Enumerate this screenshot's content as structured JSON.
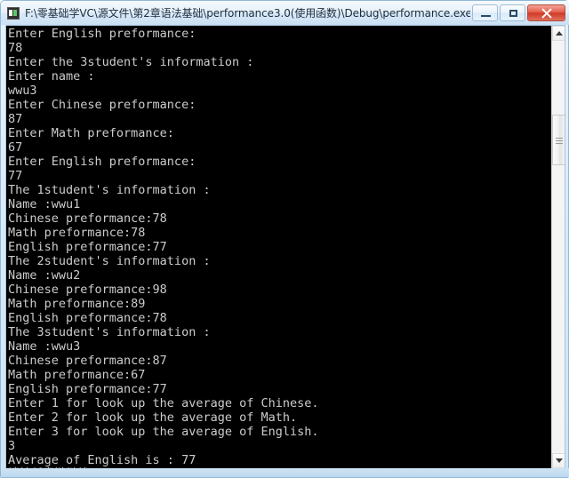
{
  "window": {
    "title": "F:\\零基础学VC\\源文件\\第2章语法基础\\performance3.0(使用函数)\\Debug\\performance.exe",
    "icon": "console-app-icon",
    "frame_color": "#cfe3f5",
    "titlebar_text_color": "#1b2d3f"
  },
  "caption_buttons": {
    "minimize_label": "Minimize",
    "maximize_label": "Maximize",
    "close_label": "Close",
    "close_color": "#cf3a26"
  },
  "console": {
    "background": "#000000",
    "foreground": "#cccccc",
    "lines": [
      "Enter English preformance:",
      "78",
      "Enter the 3student's information :",
      "Enter name :",
      "wwu3",
      "Enter Chinese preformance:",
      "87",
      "Enter Math preformance:",
      "67",
      "Enter English preformance:",
      "77",
      "The 1student's information :",
      "Name :wwu1",
      "Chinese preformance:78",
      "Math preformance:78",
      "English preformance:77",
      "The 2student's information :",
      "Name :wwu2",
      "Chinese preformance:98",
      "Math preformance:89",
      "English preformance:78",
      "The 3student's information :",
      "Name :wwu3",
      "Chinese preformance:87",
      "Math preformance:67",
      "English preformance:77",
      "Enter 1 for look up the average of Chinese.",
      "Enter 2 for look up the average of Math.",
      "Enter 3 for look up the average of English.",
      "3",
      "Average of English is : 77",
      "请按任意键继续. . ."
    ],
    "cjk_line_indexes": [
      31
    ]
  },
  "scrollbar": {
    "up_arrow": "scroll-up-arrow-icon",
    "down_arrow": "scroll-down-arrow-icon",
    "thumb": "scroll-thumb",
    "orientation": "vertical"
  }
}
